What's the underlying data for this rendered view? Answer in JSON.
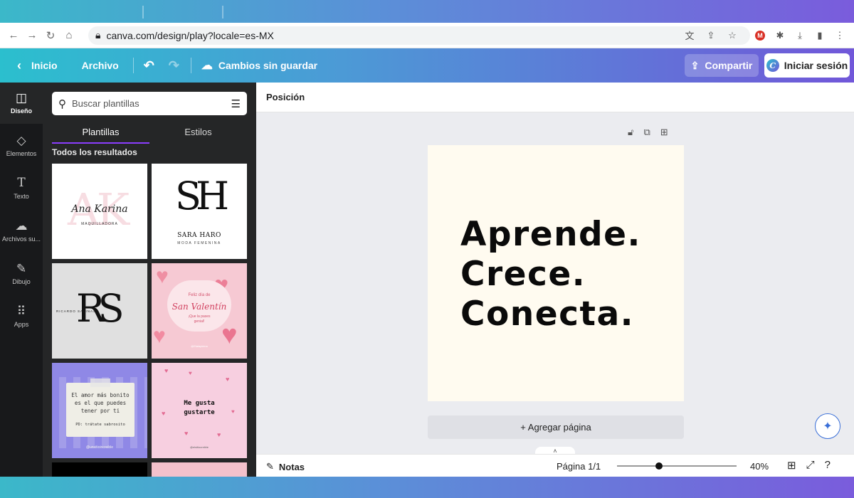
{
  "browser": {
    "url": "canva.com/design/play?locale=es-MX",
    "nav_icons": [
      "back-arrow-icon",
      "forward-arrow-icon",
      "reload-icon",
      "home-icon"
    ]
  },
  "header": {
    "home_label": "Inicio",
    "file_label": "Archivo",
    "save_status": "Cambios sin guardar",
    "share_label": "Compartir",
    "login_label": "Iniciar sesión"
  },
  "rail": {
    "items": [
      {
        "label": "Diseño",
        "icon": "layout-icon"
      },
      {
        "label": "Elementos",
        "icon": "shapes-icon"
      },
      {
        "label": "Texto",
        "icon": "text-icon"
      },
      {
        "label": "Archivos su...",
        "icon": "upload-cloud-icon"
      },
      {
        "label": "Dibujo",
        "icon": "pen-icon"
      },
      {
        "label": "Apps",
        "icon": "grid-icon"
      }
    ]
  },
  "panel": {
    "search_placeholder": "Buscar plantillas",
    "tabs": [
      "Plantillas",
      "Estilos"
    ],
    "results_title": "Todos los resultados",
    "templates": {
      "t1": {
        "script": "Ana Karina",
        "sub": "MAQUILLADORA",
        "mono": "AK"
      },
      "t2": {
        "mono": "SH",
        "name": "SARA HARO",
        "sub": "MODA FEMENINA"
      },
      "t3": {
        "mono": "RS",
        "side": "RICARDO SALINAS"
      },
      "t4": {
        "line1": "Feliz día de",
        "line2": "San Valentín",
        "line3": "¡Que la pases",
        "line4": "genial!",
        "handle": "@Elalapicina"
      },
      "t5": {
        "text": "El amor más bonito es el que puedes tener por ti",
        "ps": "PD: trátate sabrosito",
        "handle": "@unsitioincreible"
      },
      "t6": {
        "line1": "Me gusta",
        "line2": "gustarte",
        "handle": "@elsitiocreible"
      }
    }
  },
  "editor": {
    "position_label": "Posición",
    "canvas_lines": [
      "Aprende.",
      "Crece.",
      "Conecta."
    ],
    "add_page_label": "+ Agregar página",
    "notes_label": "Notas",
    "page_info": "Página 1/1",
    "zoom_percent": "40%",
    "zoom_fraction": 0.35
  }
}
